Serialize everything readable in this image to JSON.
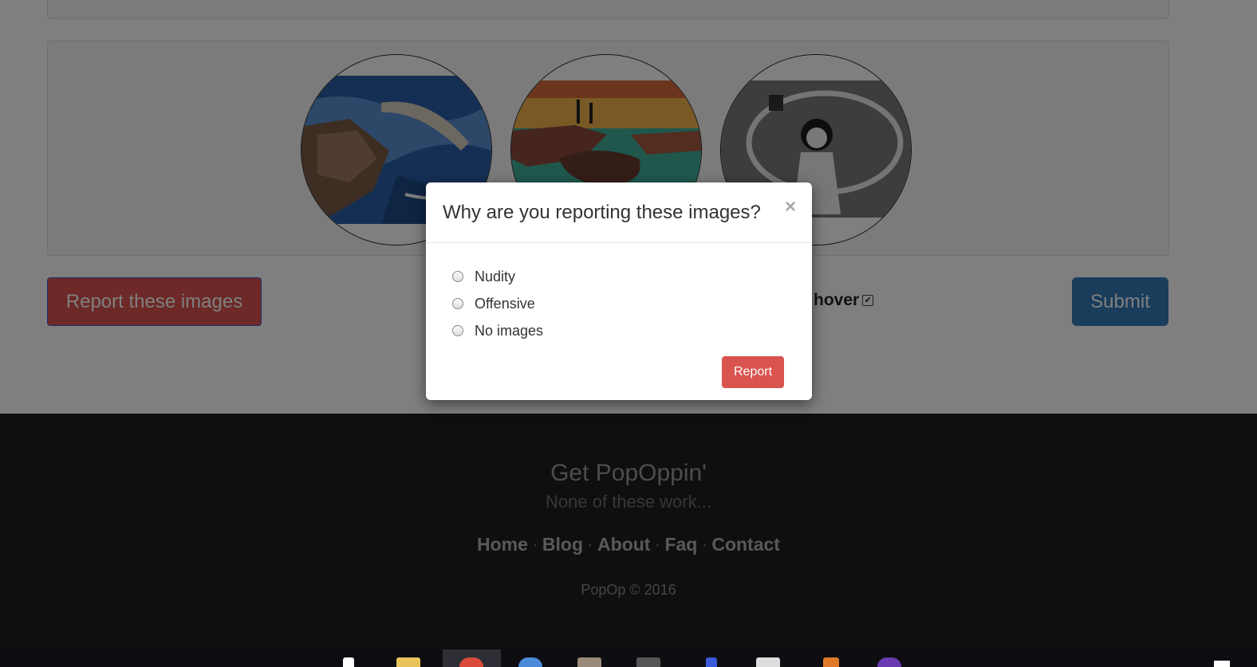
{
  "images": [
    {
      "name": "coastal painting"
    },
    {
      "name": "sunset rocks painting"
    },
    {
      "name": "child jump rope photo"
    }
  ],
  "actions": {
    "report_images_label": "Report these images",
    "hover_label": "hover",
    "hover_checked": true,
    "submit_label": "Submit"
  },
  "footer": {
    "title": "Get PopOppin'",
    "subtitle": "None of these work...",
    "nav": [
      {
        "label": "Home"
      },
      {
        "label": "Blog"
      },
      {
        "label": "About"
      },
      {
        "label": "Faq"
      },
      {
        "label": "Contact"
      }
    ],
    "separator": "·",
    "copyright": "PopOp © 2016"
  },
  "modal": {
    "title": "Why are you reporting these images?",
    "close_glyph": "×",
    "options": [
      {
        "label": "Nudity",
        "selected": false
      },
      {
        "label": "Offensive",
        "selected": false
      },
      {
        "label": "No images",
        "selected": false
      }
    ],
    "submit_label": "Report"
  },
  "colors": {
    "danger": "#d9534f",
    "primary": "#337ab7",
    "footer_bg": "#1f1f1f"
  }
}
